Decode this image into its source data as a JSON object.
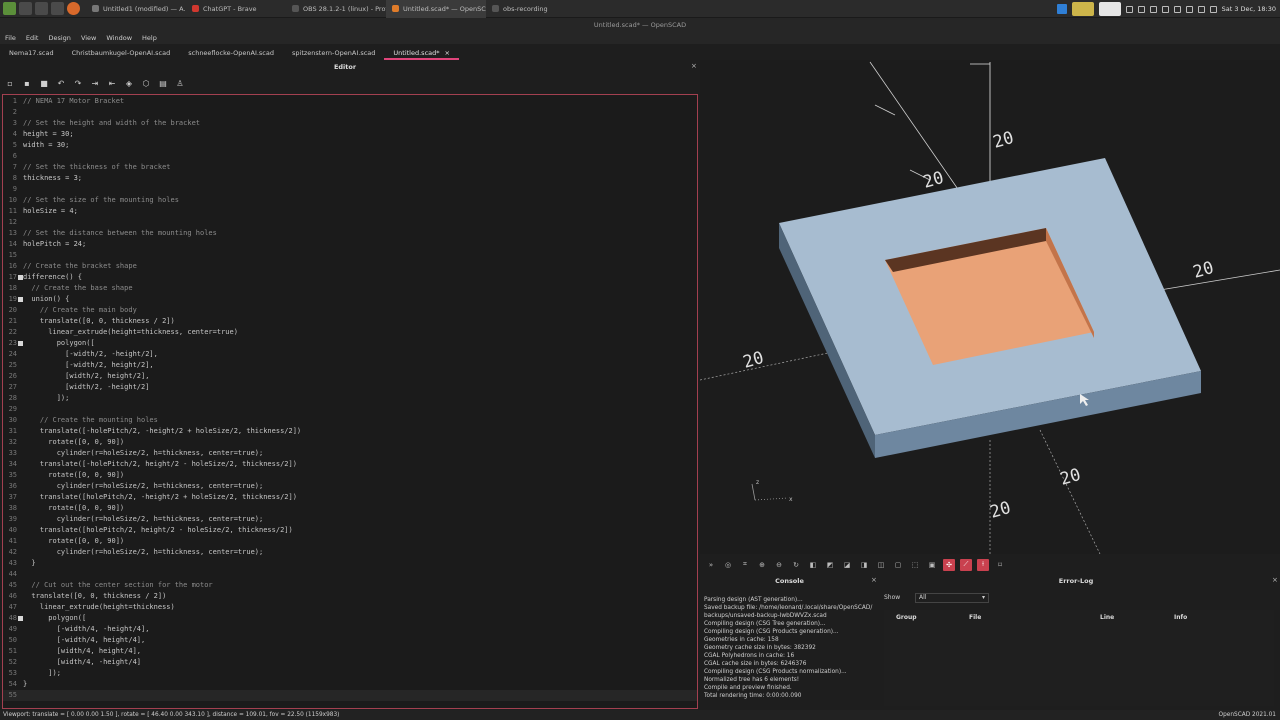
{
  "taskbar": {
    "tasks": [
      {
        "label": "Untitled1 (modified) — A...",
        "icon": "document-icon"
      },
      {
        "label": "ChatGPT - Brave",
        "icon": "brave-icon"
      },
      {
        "label": "OBS 28.1.2-1 (linux) - Profi...",
        "icon": "obs-icon"
      },
      {
        "label": "Untitled.scad* — OpenSC...",
        "icon": "openscad-icon"
      },
      {
        "label": "obs-recording",
        "icon": "folder-icon"
      }
    ],
    "clock": "Sat 3 Dec, 18:30"
  },
  "window": {
    "title": "Untitled.scad* — OpenSCAD"
  },
  "menu": [
    "File",
    "Edit",
    "Design",
    "View",
    "Window",
    "Help"
  ],
  "file_tabs": [
    "Nema17.scad",
    "Christbaumkugel-OpenAI.scad",
    "schneeflocke-OpenAI.scad",
    "spitzenstern-OpenAI.scad",
    "Untitled.scad*"
  ],
  "editor": {
    "label": "Editor",
    "lines": [
      {
        "n": "1",
        "text": "// NEMA 17 Motor Bracket",
        "cmt": true
      },
      {
        "n": "2",
        "text": ""
      },
      {
        "n": "3",
        "text": "// Set the height and width of the bracket",
        "cmt": true
      },
      {
        "n": "4",
        "text": "height = 30;"
      },
      {
        "n": "5",
        "text": "width = 30;"
      },
      {
        "n": "6",
        "text": ""
      },
      {
        "n": "7",
        "text": "// Set the thickness of the bracket",
        "cmt": true
      },
      {
        "n": "8",
        "text": "thickness = 3;"
      },
      {
        "n": "9",
        "text": ""
      },
      {
        "n": "10",
        "text": "// Set the size of the mounting holes",
        "cmt": true
      },
      {
        "n": "11",
        "text": "holeSize = 4;"
      },
      {
        "n": "12",
        "text": ""
      },
      {
        "n": "13",
        "text": "// Set the distance between the mounting holes",
        "cmt": true
      },
      {
        "n": "14",
        "text": "holePitch = 24;"
      },
      {
        "n": "15",
        "text": ""
      },
      {
        "n": "16",
        "text": "// Create the bracket shape",
        "cmt": true
      },
      {
        "n": "17",
        "text": "difference() {",
        "fold": true
      },
      {
        "n": "18",
        "text": "  // Create the base shape",
        "cmt": true
      },
      {
        "n": "19",
        "text": "  union() {",
        "fold": true
      },
      {
        "n": "20",
        "text": "    // Create the main body",
        "cmt": true
      },
      {
        "n": "21",
        "text": "    translate([0, 0, thickness / 2])"
      },
      {
        "n": "22",
        "text": "      linear_extrude(height=thickness, center=true)"
      },
      {
        "n": "23",
        "text": "        polygon([",
        "fold": true
      },
      {
        "n": "24",
        "text": "          [-width/2, -height/2],"
      },
      {
        "n": "25",
        "text": "          [-width/2, height/2],"
      },
      {
        "n": "26",
        "text": "          [width/2, height/2],"
      },
      {
        "n": "27",
        "text": "          [width/2, -height/2]"
      },
      {
        "n": "28",
        "text": "        ]);"
      },
      {
        "n": "29",
        "text": ""
      },
      {
        "n": "30",
        "text": "    // Create the mounting holes",
        "cmt": true
      },
      {
        "n": "31",
        "text": "    translate([-holePitch/2, -height/2 + holeSize/2, thickness/2])"
      },
      {
        "n": "32",
        "text": "      rotate([0, 0, 90])"
      },
      {
        "n": "33",
        "text": "        cylinder(r=holeSize/2, h=thickness, center=true);"
      },
      {
        "n": "34",
        "text": "    translate([-holePitch/2, height/2 - holeSize/2, thickness/2])"
      },
      {
        "n": "35",
        "text": "      rotate([0, 0, 90])"
      },
      {
        "n": "36",
        "text": "        cylinder(r=holeSize/2, h=thickness, center=true);"
      },
      {
        "n": "37",
        "text": "    translate([holePitch/2, -height/2 + holeSize/2, thickness/2])"
      },
      {
        "n": "38",
        "text": "      rotate([0, 0, 90])"
      },
      {
        "n": "39",
        "text": "        cylinder(r=holeSize/2, h=thickness, center=true);"
      },
      {
        "n": "40",
        "text": "    translate([holePitch/2, height/2 - holeSize/2, thickness/2])"
      },
      {
        "n": "41",
        "text": "      rotate([0, 0, 90])"
      },
      {
        "n": "42",
        "text": "        cylinder(r=holeSize/2, h=thickness, center=true);"
      },
      {
        "n": "43",
        "text": "  }"
      },
      {
        "n": "44",
        "text": ""
      },
      {
        "n": "45",
        "text": "  // Cut out the center section for the motor",
        "cmt": true
      },
      {
        "n": "46",
        "text": "  translate([0, 0, thickness / 2])"
      },
      {
        "n": "47",
        "text": "    linear_extrude(height=thickness)"
      },
      {
        "n": "48",
        "text": "      polygon([",
        "fold": true
      },
      {
        "n": "49",
        "text": "        [-width/4, -height/4],"
      },
      {
        "n": "50",
        "text": "        [-width/4, height/4],"
      },
      {
        "n": "51",
        "text": "        [width/4, height/4],"
      },
      {
        "n": "52",
        "text": "        [width/4, -height/4]"
      },
      {
        "n": "53",
        "text": "      ]);"
      },
      {
        "n": "54",
        "text": "}"
      },
      {
        "n": "55",
        "text": "",
        "cursor": true
      }
    ]
  },
  "viewport": {
    "axis_labels": [
      "20",
      "20",
      "20",
      "20",
      "20",
      "20",
      "20"
    ],
    "colors": {
      "top": "#a7bcd0",
      "side": "#4f6478",
      "front": "#6e87a0",
      "cut": "#e9a277",
      "cut_shadow": "#5b3522"
    }
  },
  "console": {
    "title": "Console",
    "lines": [
      "Parsing design (AST generation)...",
      "Saved backup file: /home/leonard/.local/share/OpenSCAD/",
      "backups/unsaved-backup-IwbDWVZx.scad",
      "Compiling design (CSG Tree generation)...",
      "Compiling design (CSG Products generation)...",
      "Geometries in cache: 158",
      "Geometry cache size in bytes: 382392",
      "CGAL Polyhedrons in cache: 16",
      "CGAL cache size in bytes: 6246376",
      "Compiling design (CSG Products normalization)...",
      "Normalized tree has 6 elements!",
      "Compile and preview finished.",
      "Total rendering time: 0:00:00.090"
    ]
  },
  "errorlog": {
    "title": "Error-Log",
    "show_label": "Show",
    "show_value": "All",
    "columns": [
      "Group",
      "File",
      "Line",
      "Info"
    ]
  },
  "status": {
    "viewport": "Viewport: translate = [ 0.00 0.00 1.50 ], rotate = [ 46.40 0.00 343.10 ], distance = 109.01, fov = 22.50 (1159x983)",
    "version": "OpenSCAD 2021.01"
  }
}
